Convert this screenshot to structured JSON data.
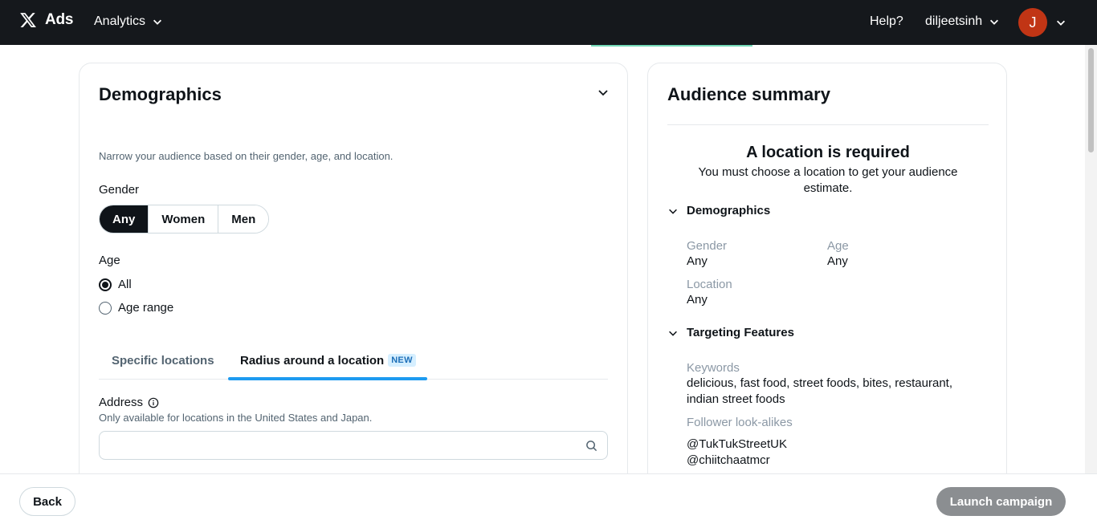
{
  "header": {
    "brand": "Ads",
    "nav_analytics": "Analytics",
    "help": "Help?",
    "username": "diljeetsinh",
    "avatar_initial": "J"
  },
  "demographics": {
    "title": "Demographics",
    "description": "Narrow your audience based on their gender, age, and location.",
    "gender_label": "Gender",
    "gender_options": [
      "Any",
      "Women",
      "Men"
    ],
    "gender_selected": "Any",
    "age_label": "Age",
    "age_options": [
      "All",
      "Age range"
    ],
    "age_selected": "All",
    "location_tabs": [
      "Specific locations",
      "Radius around a location"
    ],
    "active_tab": "Radius around a location",
    "new_badge": "NEW",
    "address_label": "Address",
    "address_hint": "Only available for locations in the United States and Japan.",
    "address_value": ""
  },
  "summary": {
    "title": "Audience summary",
    "required_title": "A location is required",
    "required_text": "You must choose a location to get your audience estimate.",
    "demographics_header": "Demographics",
    "gender_key": "Gender",
    "gender_value": "Any",
    "age_key": "Age",
    "age_value": "Any",
    "location_key": "Location",
    "location_value": "Any",
    "targeting_header": "Targeting Features",
    "keywords_key": "Keywords",
    "keywords_value": "delicious, fast food, street foods, bites, restaurant, indian street foods",
    "lookalikes_key": "Follower look-alikes",
    "lookalikes": [
      "@TukTukStreetUK",
      "@chiitchaatmcr"
    ]
  },
  "footer": {
    "back": "Back",
    "launch": "Launch campaign"
  },
  "colors": {
    "topbar": "#15181c",
    "accent_tab": "#1d9bf0",
    "avatar": "#c13515",
    "launch_disabled": "#8b8e91"
  }
}
